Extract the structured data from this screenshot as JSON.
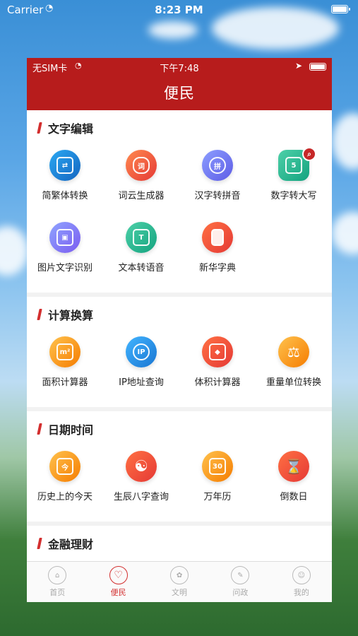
{
  "outer_status": {
    "carrier": "Carrier",
    "time": "8:23 PM"
  },
  "inner_status": {
    "carrier": "无SIM卡",
    "time": "下午7:48"
  },
  "header": {
    "title": "便民"
  },
  "sections": [
    {
      "title": "文字编辑",
      "items": [
        {
          "label": "简繁体转换",
          "icon": "convert-icon",
          "color": "#1e88e5"
        },
        {
          "label": "词云生成器",
          "icon": "cloud-icon",
          "color": "#f4511e"
        },
        {
          "label": "汉字转拼音",
          "icon": "pinyin-icon",
          "color": "#7c83f5"
        },
        {
          "label": "数字转大写",
          "icon": "number-icon",
          "color": "#20b486"
        },
        {
          "label": "图片文字识别",
          "icon": "image-ocr-icon",
          "color": "#7c6cf2"
        },
        {
          "label": "文本转语音",
          "icon": "text-to-speech-icon",
          "color": "#20b486"
        },
        {
          "label": "新华字典",
          "icon": "dictionary-icon",
          "color": "#f4511e"
        }
      ]
    },
    {
      "title": "计算换算",
      "items": [
        {
          "label": "面积计算器",
          "icon": "area-icon",
          "color": "#fb8c00"
        },
        {
          "label": "IP地址查询",
          "icon": "ip-search-icon",
          "color": "#1e88e5"
        },
        {
          "label": "体积计算器",
          "icon": "volume-cube-icon",
          "color": "#f4511e"
        },
        {
          "label": "重量单位转换",
          "icon": "scale-icon",
          "color": "#fb8c00"
        }
      ]
    },
    {
      "title": "日期时间",
      "items": [
        {
          "label": "历史上的今天",
          "icon": "calendar-today-icon",
          "color": "#fb8c00"
        },
        {
          "label": "生辰八字查询",
          "icon": "yin-yang-icon",
          "color": "#e53935"
        },
        {
          "label": "万年历",
          "icon": "calendar-30-icon",
          "color": "#fb8c00"
        },
        {
          "label": "倒数日",
          "icon": "hourglass-icon",
          "color": "#e53935"
        }
      ]
    },
    {
      "title": "金融理财",
      "items": [
        {
          "label": "",
          "icon": "finance-icon-1",
          "color": "#7c83f5"
        },
        {
          "label": "",
          "icon": "finance-icon-2",
          "color": "#fb8c00"
        }
      ]
    }
  ],
  "tabs": [
    {
      "label": "首页",
      "icon": "home-icon",
      "active": false
    },
    {
      "label": "便民",
      "icon": "heart-icon",
      "active": true
    },
    {
      "label": "文明",
      "icon": "emblem-icon",
      "active": false
    },
    {
      "label": "问政",
      "icon": "speech-icon",
      "active": false
    },
    {
      "label": "我的",
      "icon": "user-icon",
      "active": false
    }
  ],
  "colors": {
    "header_bg": "#b71c1c",
    "accent": "#d32f2f"
  }
}
